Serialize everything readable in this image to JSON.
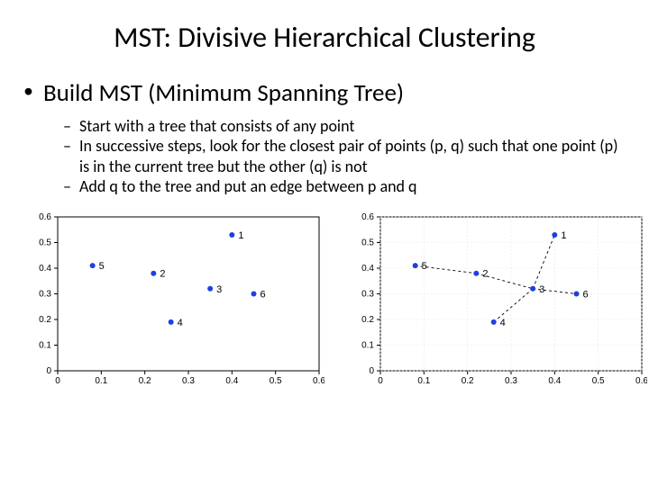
{
  "title": "MST: Divisive Hierarchical Clustering",
  "bullet_main": "Build MST (Minimum Spanning Tree)",
  "sub": {
    "a": "Start with a tree that consists of any point",
    "b": "In successive steps, look for the closest pair of points (p, q)  such that one point (p) is in the current tree but the other (q) is not",
    "c": "Add q to the tree and put an edge between p and q"
  },
  "chart_data": [
    {
      "type": "scatter",
      "title": "",
      "xlim": [
        0,
        0.6
      ],
      "ylim": [
        0,
        0.6
      ],
      "xticks": [
        0,
        0.1,
        0.2,
        0.3,
        0.4,
        0.5,
        0.6
      ],
      "yticks": [
        0,
        0.1,
        0.2,
        0.3,
        0.4,
        0.5,
        0.6
      ],
      "points": [
        {
          "id": "1",
          "x": 0.4,
          "y": 0.53
        },
        {
          "id": "2",
          "x": 0.22,
          "y": 0.38
        },
        {
          "id": "3",
          "x": 0.35,
          "y": 0.32
        },
        {
          "id": "4",
          "x": 0.26,
          "y": 0.19
        },
        {
          "id": "5",
          "x": 0.08,
          "y": 0.41
        },
        {
          "id": "6",
          "x": 0.45,
          "y": 0.3
        }
      ],
      "edges": []
    },
    {
      "type": "scatter",
      "title": "",
      "xlim": [
        0,
        0.6
      ],
      "ylim": [
        0,
        0.6
      ],
      "xticks": [
        0,
        0.1,
        0.2,
        0.3,
        0.4,
        0.5,
        0.6
      ],
      "yticks": [
        0,
        0.1,
        0.2,
        0.3,
        0.4,
        0.5,
        0.6
      ],
      "points": [
        {
          "id": "1",
          "x": 0.4,
          "y": 0.53
        },
        {
          "id": "2",
          "x": 0.22,
          "y": 0.38
        },
        {
          "id": "3",
          "x": 0.35,
          "y": 0.32
        },
        {
          "id": "4",
          "x": 0.26,
          "y": 0.19
        },
        {
          "id": "5",
          "x": 0.08,
          "y": 0.41
        },
        {
          "id": "6",
          "x": 0.45,
          "y": 0.3
        }
      ],
      "edges": [
        [
          "5",
          "2"
        ],
        [
          "2",
          "3"
        ],
        [
          "3",
          "6"
        ],
        [
          "3",
          "4"
        ],
        [
          "3",
          "1"
        ]
      ]
    }
  ]
}
